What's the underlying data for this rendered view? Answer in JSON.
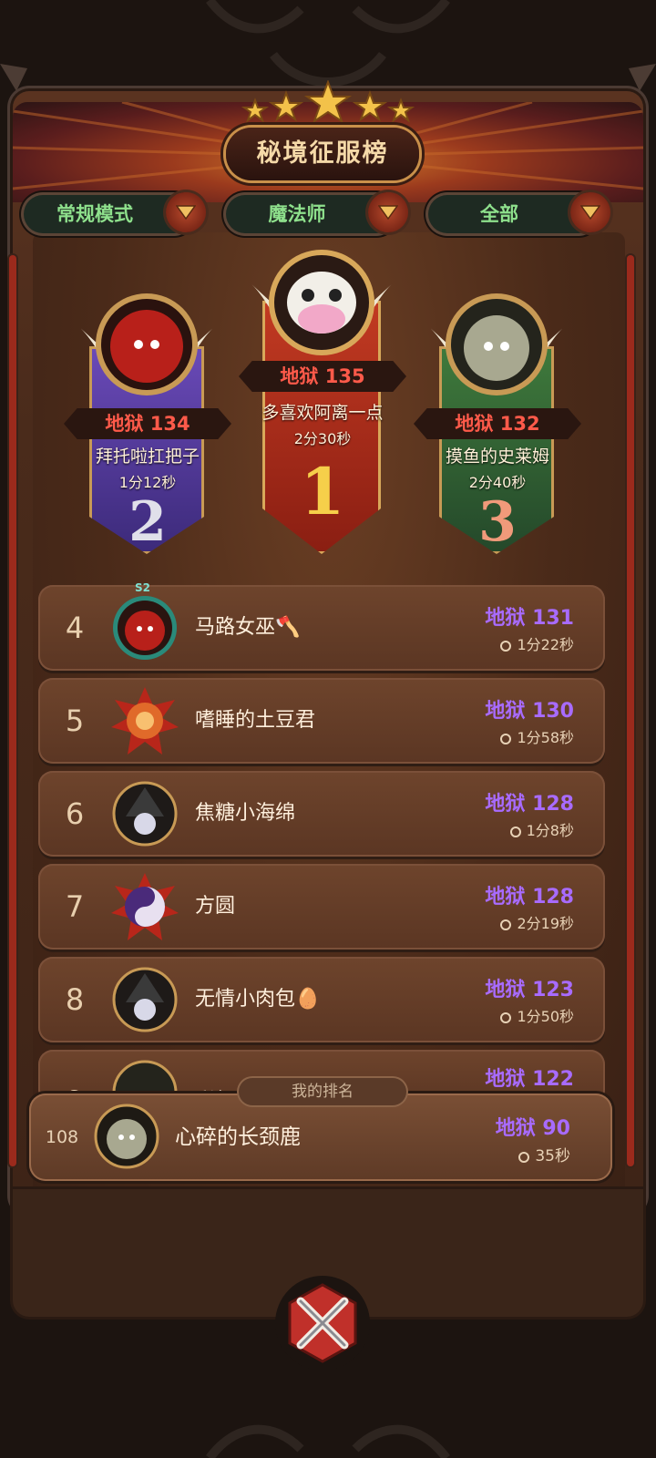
{
  "title": "秘境征服榜",
  "filters": [
    {
      "label": "常规模式"
    },
    {
      "label": "魔法师"
    },
    {
      "label": "全部"
    }
  ],
  "podium": [
    {
      "rank": "2",
      "score": "地狱 134",
      "name": "拜托啦扛把子",
      "time": "1分12秒"
    },
    {
      "rank": "1",
      "score": "地狱 135",
      "name": "多喜欢阿离一点",
      "time": "2分30秒"
    },
    {
      "rank": "3",
      "score": "地狱 132",
      "name": "摸鱼的史莱姆",
      "time": "2分40秒"
    }
  ],
  "rows": [
    {
      "rank": "4",
      "name": "马路女巫🪓",
      "score": "地狱 131",
      "time": "1分22秒",
      "badge": "S2"
    },
    {
      "rank": "5",
      "name": "嗜睡的土豆君",
      "score": "地狱 130",
      "time": "1分58秒"
    },
    {
      "rank": "6",
      "name": "焦糖小海绵",
      "score": "地狱 128",
      "time": "1分8秒"
    },
    {
      "rank": "7",
      "name": "方圆",
      "score": "地狱 128",
      "time": "2分19秒"
    },
    {
      "rank": "8",
      "name": "无情小肉包🥚",
      "score": "地狱 123",
      "time": "1分50秒"
    },
    {
      "rank": "9",
      "name": "彩虹",
      "score": "地狱 122",
      "time": ""
    }
  ],
  "my_rank": {
    "tag": "我的排名",
    "rank": "108",
    "name": "心碎的长颈鹿",
    "score": "地狱 90",
    "time": "35秒"
  },
  "colors": {
    "score_purple": "#a86bff",
    "score_red": "#ff5a4a",
    "filter_green": "#8ee08c"
  }
}
